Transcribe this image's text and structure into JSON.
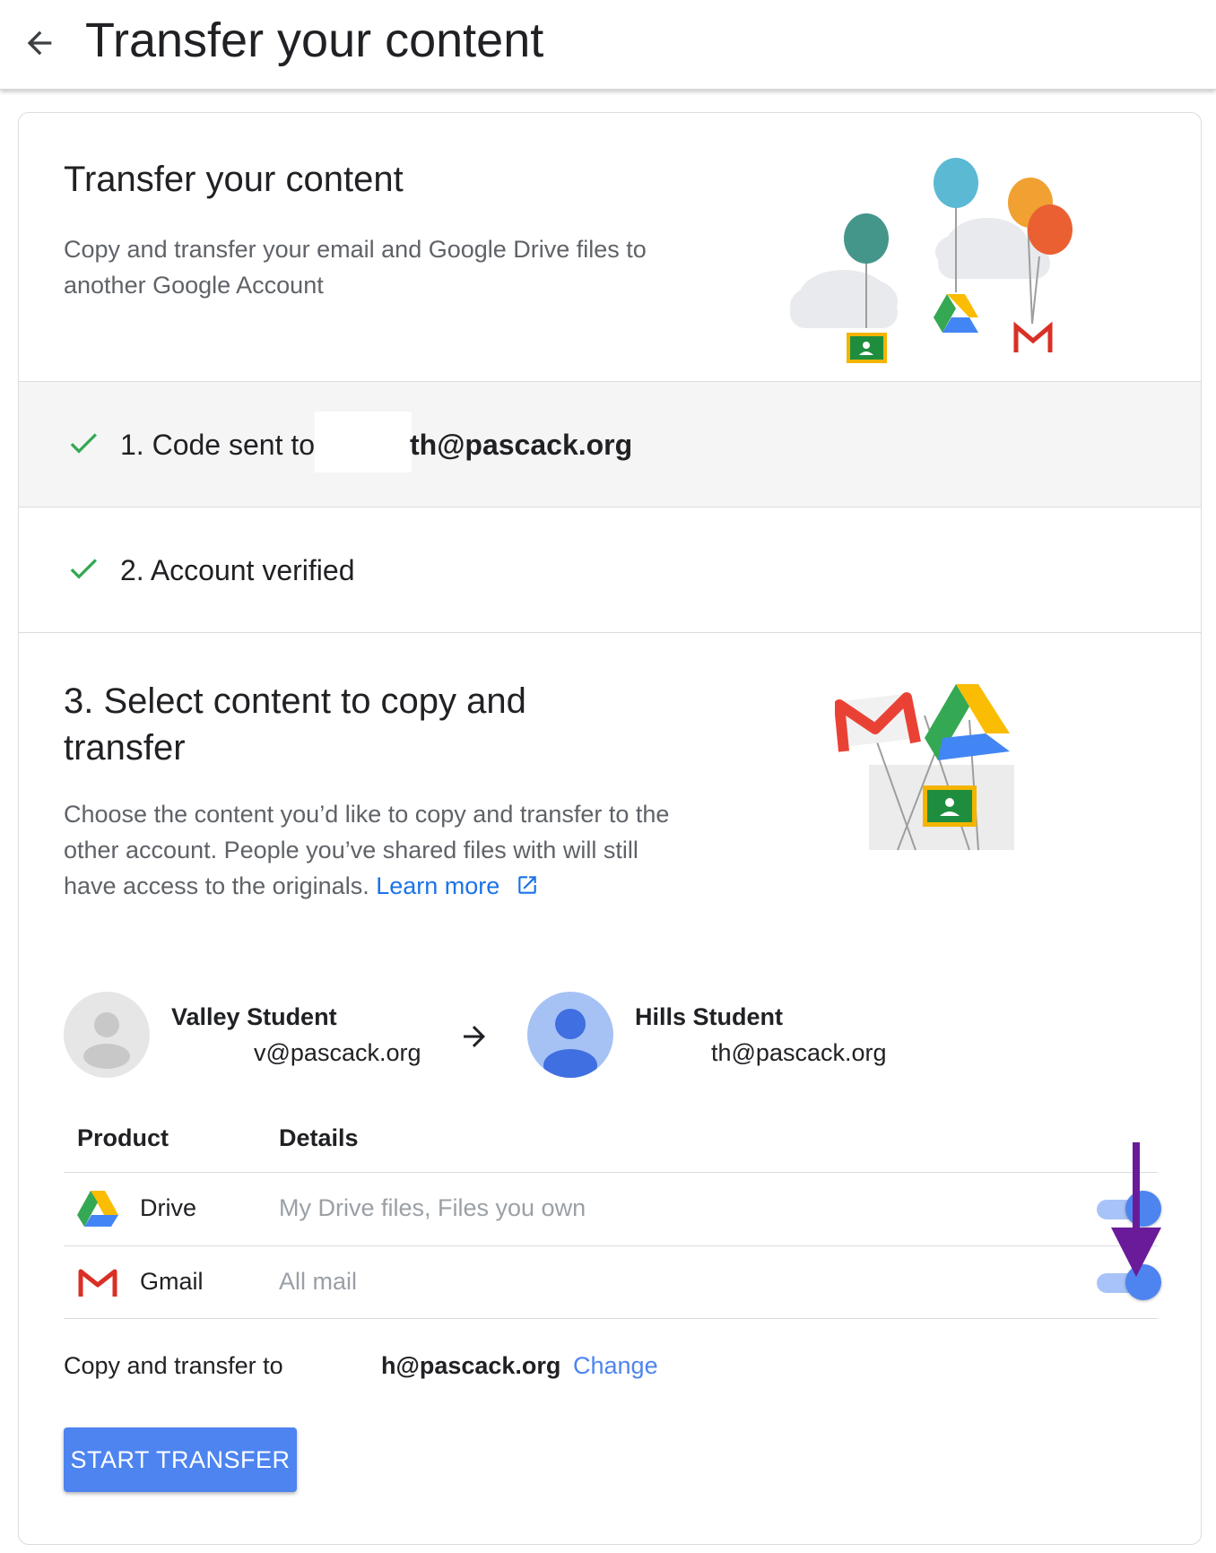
{
  "header": {
    "title": "Transfer your content",
    "back_icon": "arrow-back-icon"
  },
  "intro": {
    "title": "Transfer your content",
    "description": "Copy and transfer your email and Google Drive files to another Google Account"
  },
  "steps": [
    {
      "label": "1. Code sent to",
      "email": "th@pascack.org",
      "status": "done"
    },
    {
      "label": "2. Account verified",
      "status": "done"
    }
  ],
  "select": {
    "title": "3. Select content to copy and transfer",
    "description": "Choose the content you’d like to copy and transfer to the other account. People you’ve shared files with will still have access to the originals.",
    "learn_more": "Learn more"
  },
  "accounts": {
    "from": {
      "name": "Valley Student",
      "email": "v@pascack.org"
    },
    "to": {
      "name": "Hills Student",
      "email": "th@pascack.org"
    }
  },
  "table": {
    "headers": {
      "product": "Product",
      "details": "Details"
    },
    "rows": [
      {
        "product": "Drive",
        "details": "My Drive files, Files you own",
        "enabled": true,
        "icon": "google-drive-icon"
      },
      {
        "product": "Gmail",
        "details": "All mail",
        "enabled": true,
        "icon": "gmail-icon"
      }
    ]
  },
  "copy_to": {
    "label": "Copy and transfer to",
    "email": "h@pascack.org",
    "change": "Change"
  },
  "actions": {
    "start": "START TRANSFER"
  },
  "colors": {
    "primary": "#4d84f0",
    "link": "#1a73e8",
    "check": "#34a853",
    "annotation": "#6a1b9a",
    "toggle_track": "#a8c3f7"
  }
}
